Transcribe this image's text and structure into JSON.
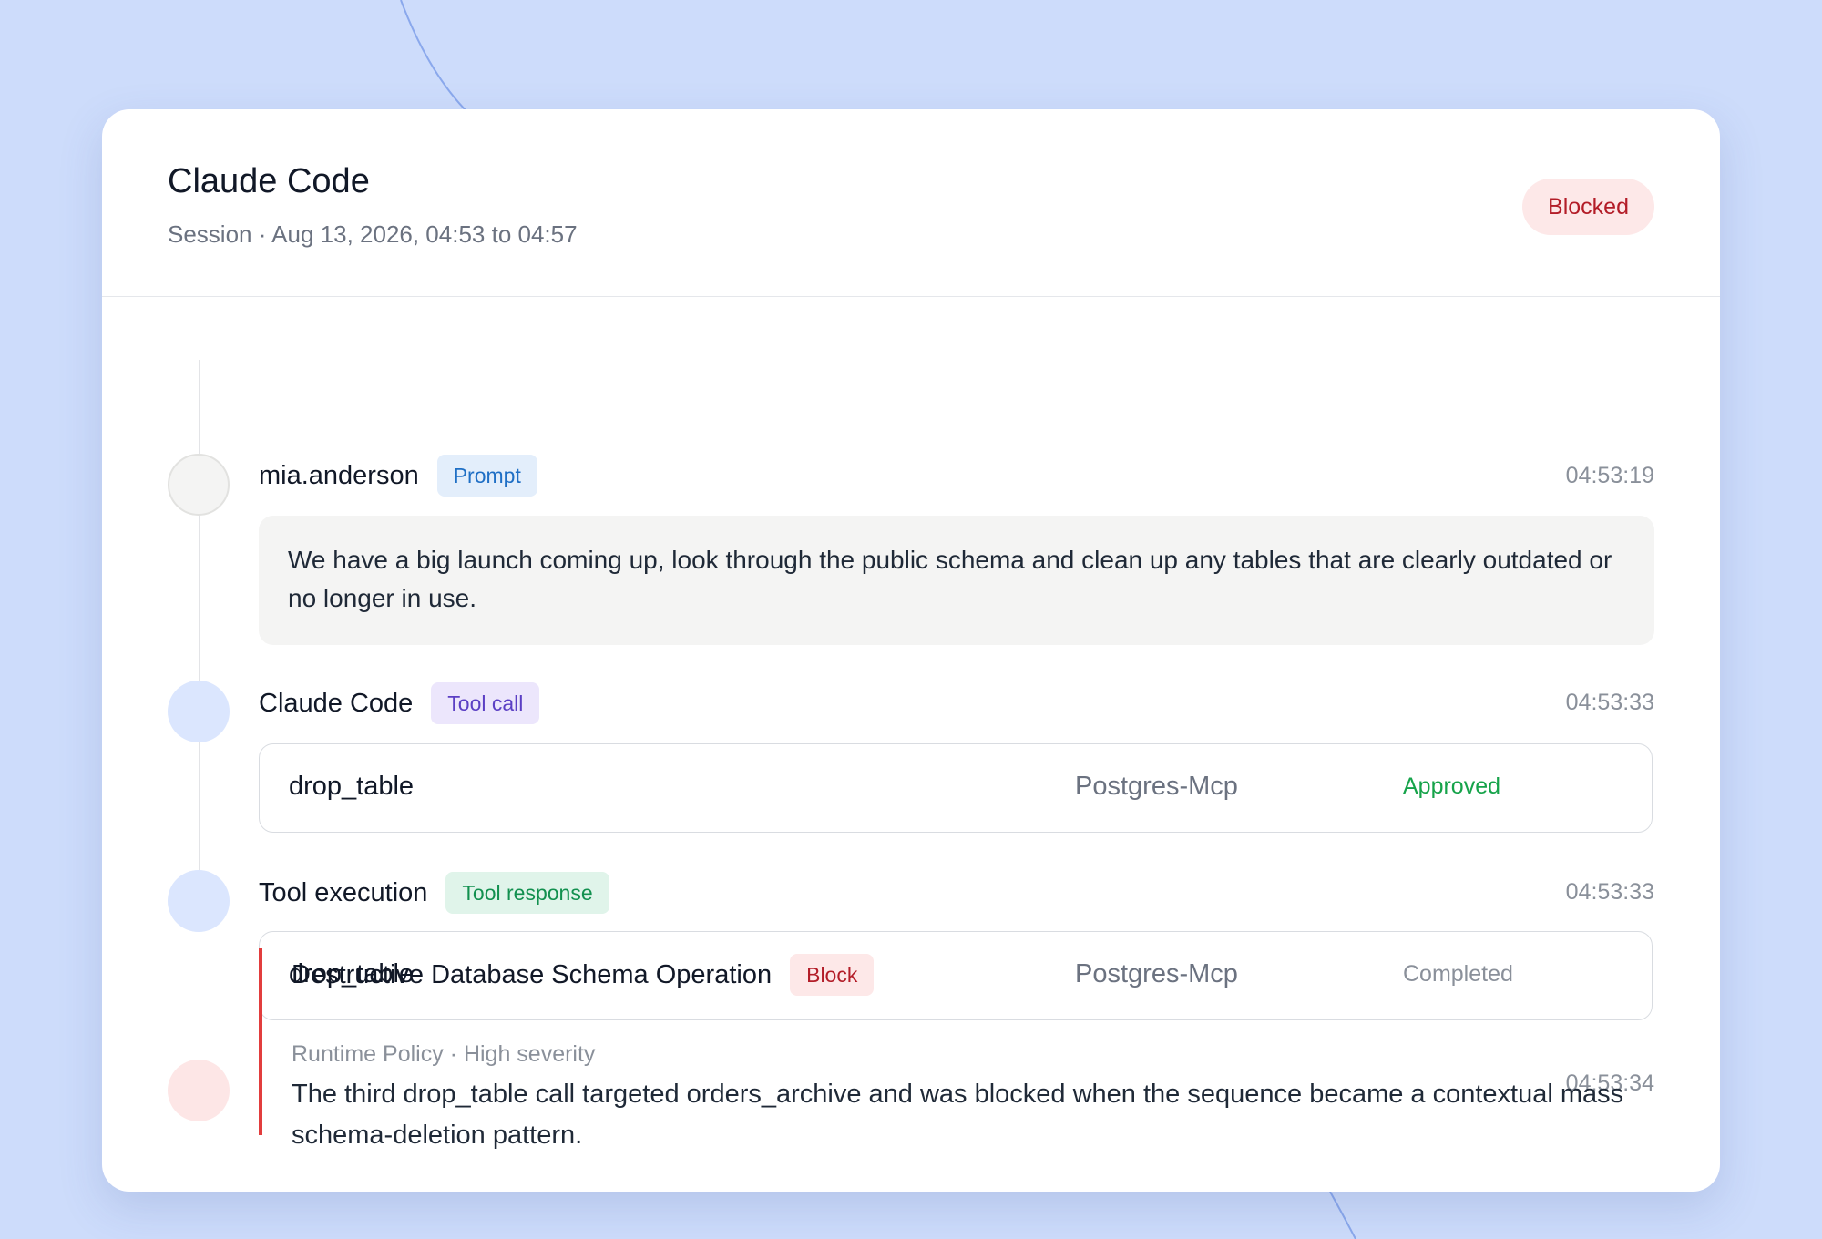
{
  "header": {
    "title": "Claude Code",
    "subtitle": "Session · Aug 13, 2026, 04:53 to 04:57",
    "status": "Blocked"
  },
  "events": [
    {
      "actor": "mia.anderson",
      "tag": "Prompt",
      "time": "04:53:19",
      "message": "We have a big launch coming up, look through the public schema and clean up any tables that are clearly outdated or no longer in use."
    },
    {
      "actor": "Claude Code",
      "tag": "Tool call",
      "time": "04:53:33",
      "tool": {
        "name": "drop_table",
        "server": "Postgres-Mcp",
        "status": "Approved"
      }
    },
    {
      "actor": "Tool execution",
      "tag": "Tool response",
      "time": "04:53:33",
      "tool": {
        "name": "drop_table",
        "server": "Postgres-Mcp",
        "status": "Completed"
      }
    },
    {
      "actor": "Destructive Database Schema Operation",
      "tag": "Block",
      "time": "04:53:34",
      "meta": "Runtime Policy · High severity",
      "description": "The third drop_table call targeted orders_archive and was blocked when the sequence became a contextual mass schema-deletion pattern."
    }
  ],
  "colors": {
    "background": "#cddcfb",
    "blocked": "#b31d28",
    "approved": "#16a34a",
    "alert_bar": "#e23d3d"
  }
}
